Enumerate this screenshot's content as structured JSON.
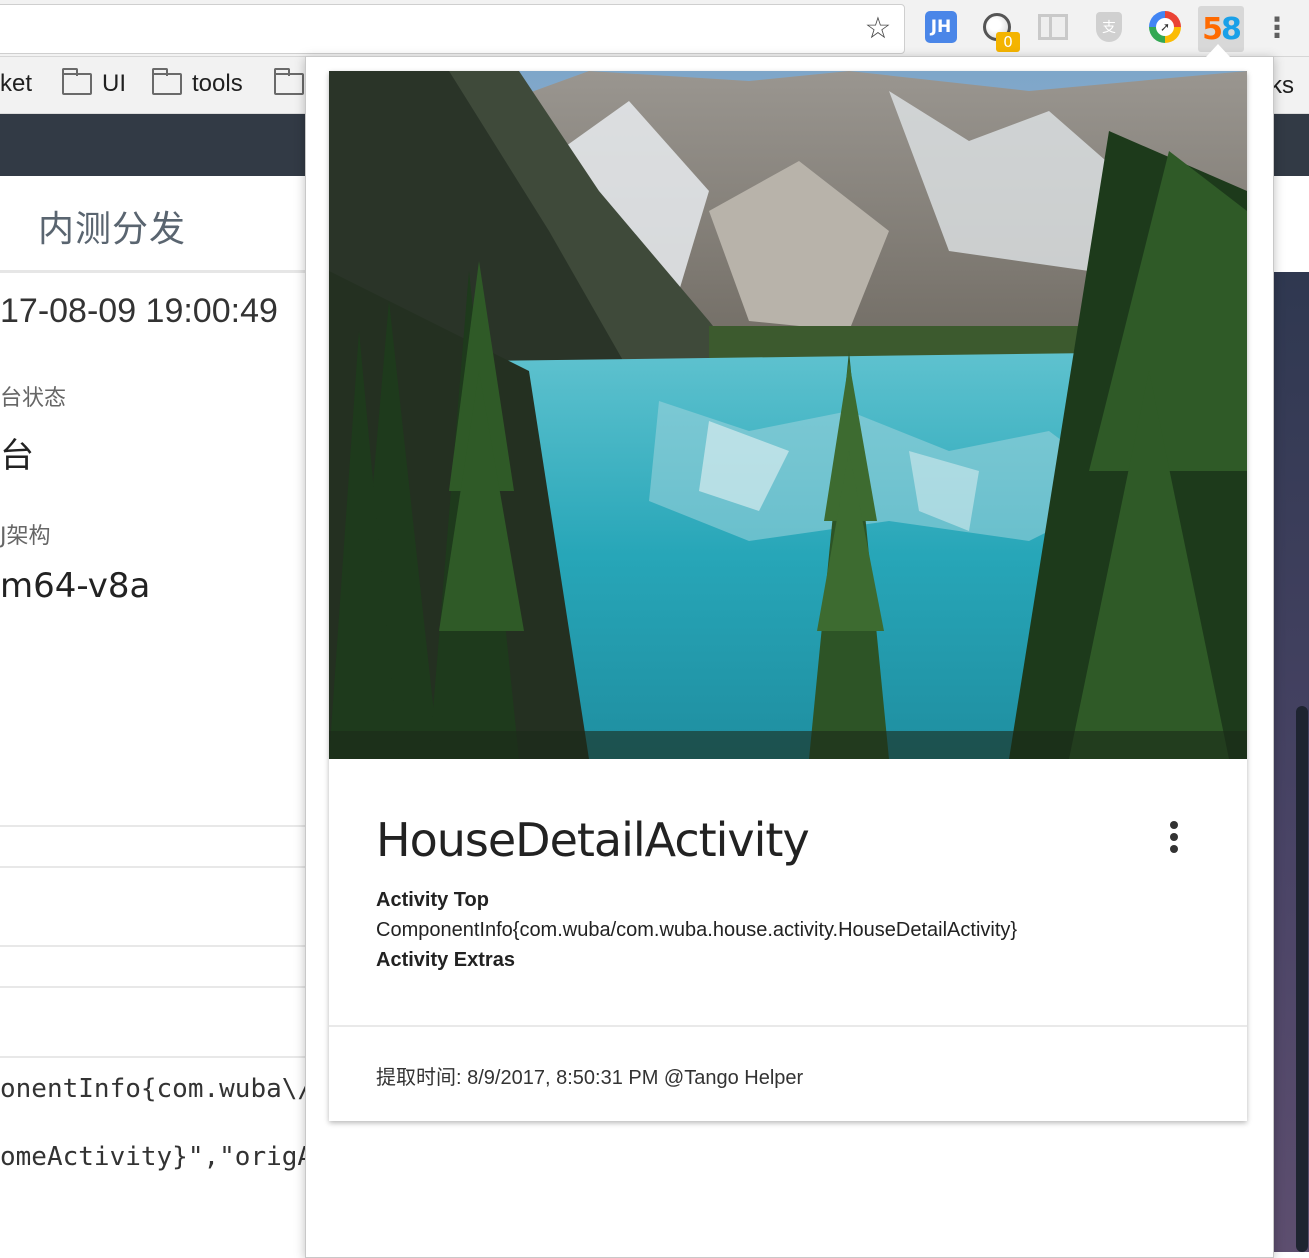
{
  "browser": {
    "extensions": {
      "jh_label": "JH",
      "badge_count": "0",
      "shield_glyph": "支",
      "logo_5": "5",
      "logo_8": "8"
    },
    "bookmarks": [
      {
        "label": "ket"
      },
      {
        "label": "UI"
      },
      {
        "label": "tools"
      },
      {
        "label": "ks"
      }
    ]
  },
  "page": {
    "title": "内测分发",
    "date": "17-08-09 19:00:49",
    "field1_label": "台状态",
    "field1_value": "台",
    "field2_label": "J架构",
    "field2_value": "m64-v8a",
    "code_line1": "onentInfo{com.wuba\\/c",
    "code_line2": "omeActivity}\",\"origAc"
  },
  "card": {
    "title": "HouseDetailActivity",
    "activity_top_label": "Activity Top",
    "component_info": "ComponentInfo{com.wuba/com.wuba.house.activity.HouseDetailActivity}",
    "activity_extras_label": "Activity Extras",
    "footer_label": "提取时间:",
    "footer_value": "8/9/2017, 8:50:31 PM @Tango Helper"
  },
  "icons": {
    "star": "star-icon",
    "menu": "more-vertical-icon",
    "folder": "folder-icon",
    "card_menu": "more-vertical-icon"
  },
  "colors": {
    "page_header": "#323a45",
    "jh_bg": "#4a86e8",
    "badge": "#f4b400",
    "lake": "#27a6b8"
  }
}
